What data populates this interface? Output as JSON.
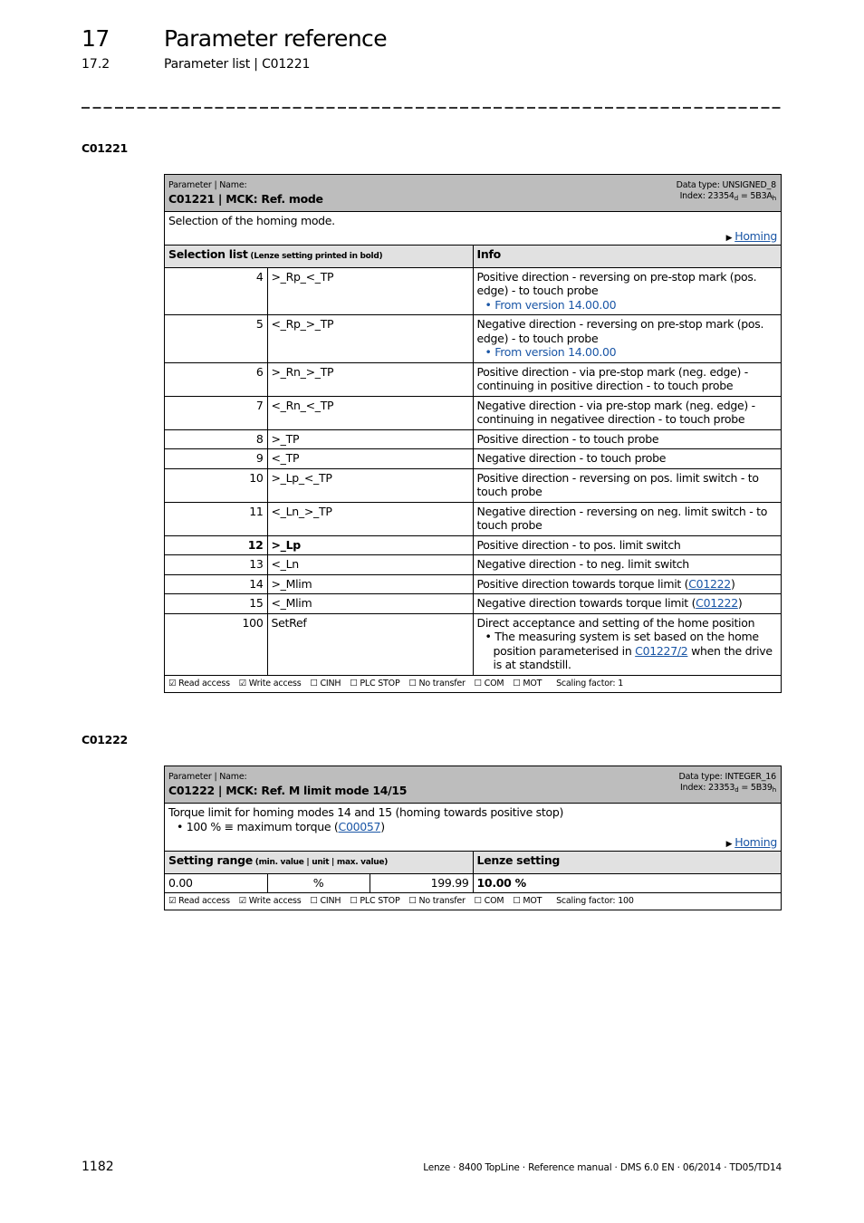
{
  "header": {
    "chapter_number": "17",
    "chapter_title": "Parameter reference",
    "section_number": "17.2",
    "section_title": "Parameter list | C01221"
  },
  "parameters": [
    {
      "heading": "C01221",
      "label": "Parameter | Name:",
      "name": "C01221 | MCK: Ref. mode",
      "data_type": "Data type: UNSIGNED_8",
      "index_prefix": "Index: 23354",
      "index_dec_sub": "d",
      "index_hex": " = 5B3A",
      "index_hex_sub": "h",
      "description": "Selection of the homing mode.",
      "homing_link": "Homing",
      "table_header": {
        "col1_main": "Selection list",
        "col1_note": " (Lenze setting printed in bold)",
        "col2": "Info"
      },
      "rows": [
        {
          "value": "4",
          "name": ">_Rp_<_TP",
          "info": "Positive direction - reversing on pre-stop mark (pos. edge) - to touch probe",
          "note": "From version 14.00.00"
        },
        {
          "value": "5",
          "name": "<_Rp_>_TP",
          "info": "Negative direction - reversing on pre-stop mark (pos. edge) - to touch probe",
          "note": "From version 14.00.00"
        },
        {
          "value": "6",
          "name": ">_Rn_>_TP",
          "info": "Positive direction - via pre-stop mark (neg. edge) - continuing in positive direction - to touch probe"
        },
        {
          "value": "7",
          "name": "<_Rn_<_TP",
          "info": "Negative direction - via pre-stop mark (neg. edge) - continuing in negativee direction - to touch probe"
        },
        {
          "value": "8",
          "name": ">_TP",
          "info": "Positive direction - to touch probe"
        },
        {
          "value": "9",
          "name": "<_TP",
          "info": "Negative direction - to touch probe"
        },
        {
          "value": "10",
          "name": ">_Lp_<_TP",
          "info": "Positive direction - reversing on pos. limit switch - to touch probe"
        },
        {
          "value": "11",
          "name": "<_Ln_>_TP",
          "info": "Negative direction - reversing on neg. limit switch - to touch probe"
        },
        {
          "value": "12",
          "name": ">_Lp",
          "info": "Positive direction - to pos. limit switch",
          "bold": true
        },
        {
          "value": "13",
          "name": "<_Ln",
          "info": "Negative direction - to neg. limit switch"
        },
        {
          "value": "14",
          "name": ">_Mlim",
          "info_prefix": "Positive direction towards torque limit (",
          "info_link": "C01222",
          "info_suffix": ")"
        },
        {
          "value": "15",
          "name": "<_Mlim",
          "info_prefix": "Negative direction towards torque limit (",
          "info_link": "C01222",
          "info_suffix": ")"
        },
        {
          "value": "100",
          "name": "SetRef",
          "info": "Direct acceptance and setting of the home position",
          "bullet_prefix": "The measuring system is set based on the home position parameterised in ",
          "bullet_link": "C01227/2",
          "bullet_suffix": " when the drive is at standstill."
        }
      ],
      "access": {
        "read": "☑ Read access",
        "write": "☑ Write access",
        "cinh": "☐ CINH",
        "plc_stop": "☐ PLC STOP",
        "no_transfer": "☐ No transfer",
        "com": "☐ COM",
        "mot": "☐ MOT",
        "scaling": "Scaling factor: 1"
      }
    },
    {
      "heading": "C01222",
      "label": "Parameter | Name:",
      "name": "C01222 | MCK: Ref. M limit mode 14/15",
      "data_type": "Data type: INTEGER_16",
      "index_prefix": "Index: 23353",
      "index_dec_sub": "d",
      "index_hex": " = 5B39",
      "index_hex_sub": "h",
      "description": "Torque limit for homing modes 14 and 15 (homing towards positive stop)",
      "bullet_prefix": "100 % ≡ maximum torque (",
      "bullet_link": "C00057",
      "bullet_suffix": ")",
      "homing_link": "Homing",
      "table_header": {
        "col1_main": "Setting range",
        "col1_note": " (min. value | unit | max. value)",
        "col2": "Lenze setting"
      },
      "range": {
        "min": "0.00",
        "unit": "%",
        "max": "199.99",
        "lenze_setting": "10.00 %"
      },
      "access": {
        "read": "☑ Read access",
        "write": "☑ Write access",
        "cinh": "☐ CINH",
        "plc_stop": "☐ PLC STOP",
        "no_transfer": "☐ No transfer",
        "com": "☐ COM",
        "mot": "☐ MOT",
        "scaling": "Scaling factor: 100"
      }
    }
  ],
  "footer": {
    "page_number": "1182",
    "document_info": "Lenze · 8400 TopLine · Reference manual · DMS 6.0 EN · 06/2014 · TD05/TD14"
  }
}
